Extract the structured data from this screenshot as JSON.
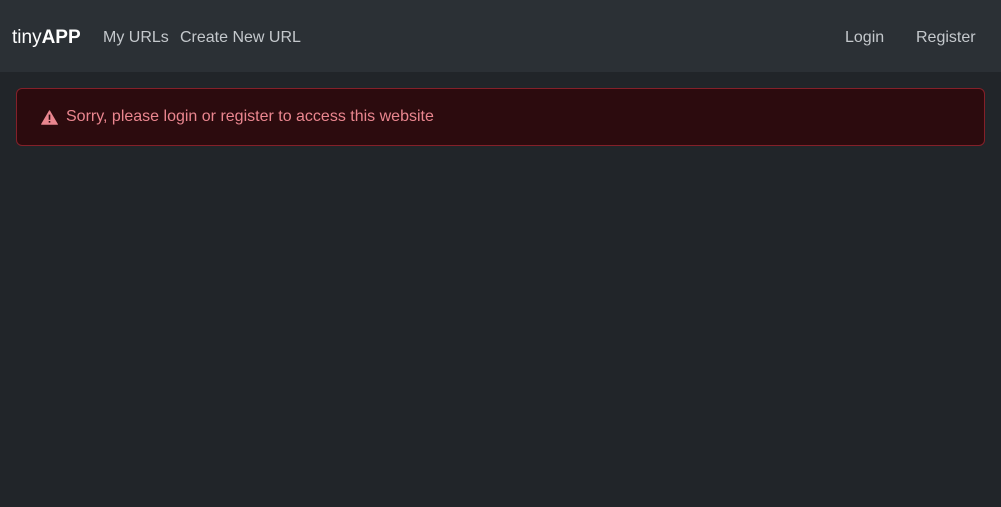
{
  "navbar": {
    "brand": {
      "light": "tiny",
      "bold": "APP"
    },
    "left_links": [
      "My URLs",
      "Create New URL"
    ],
    "right_links": [
      "Login",
      "Register"
    ]
  },
  "alert": {
    "icon": "warning-triangle-icon",
    "message": "Sorry, please login or register to access this website"
  },
  "colors": {
    "page_background": "#212529",
    "navbar_background": "#2b3035",
    "alert_background": "#2c0b0e",
    "alert_border": "#842029",
    "alert_text": "#ea868f"
  }
}
